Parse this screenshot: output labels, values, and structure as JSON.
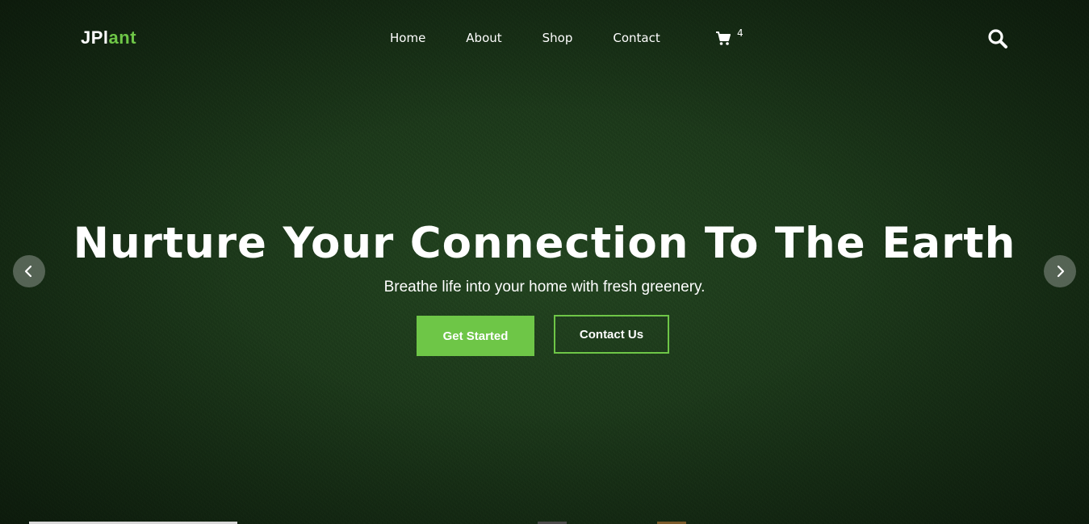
{
  "brand": {
    "logo_part1": "JPl",
    "logo_part2": "ant",
    "accent_color": "#6ec647"
  },
  "nav": {
    "links": [
      {
        "label": "Home"
      },
      {
        "label": "About"
      },
      {
        "label": "Shop"
      },
      {
        "label": "Contact"
      }
    ],
    "cart_icon": "cart-icon",
    "cart_count": "4",
    "search_icon": "search-icon"
  },
  "hero": {
    "headline": "Nurture Your Connection To The Earth",
    "subheadline": "Breathe life into your home with fresh greenery.",
    "primary_button": "Get Started",
    "secondary_button": "Contact Us",
    "prev_icon": "chevron-left-icon",
    "next_icon": "chevron-right-icon"
  },
  "colors": {
    "background": "#1e3a1c",
    "text": "#ffffff",
    "accent": "#6ec647"
  }
}
